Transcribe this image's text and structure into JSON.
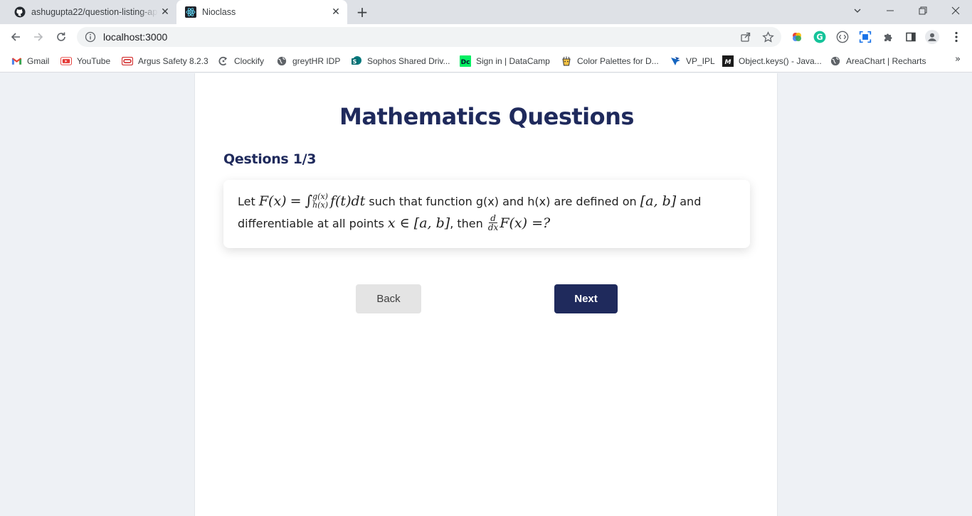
{
  "browser": {
    "tabs": [
      {
        "title": "ashugupta22/question-listing-ap",
        "icon": "github-icon",
        "active": false
      },
      {
        "title": "Nioclass",
        "icon": "react-icon",
        "active": true
      }
    ],
    "address": "localhost:3000",
    "bookmarks": [
      {
        "label": "Gmail",
        "icon": "gmail-icon"
      },
      {
        "label": "YouTube",
        "icon": "youtube-icon"
      },
      {
        "label": "Argus Safety 8.2.3",
        "icon": "oracle-icon"
      },
      {
        "label": "Clockify",
        "icon": "clockify-icon"
      },
      {
        "label": "greytHR IDP",
        "icon": "globe-icon"
      },
      {
        "label": "Sophos Shared Driv...",
        "icon": "sharepoint-icon"
      },
      {
        "label": "Sign in | DataCamp",
        "icon": "datacamp-icon"
      },
      {
        "label": "Color Palettes for D...",
        "icon": "palette-icon"
      },
      {
        "label": "VP_IPL",
        "icon": "vp-icon"
      },
      {
        "label": "Object.keys() - Java...",
        "icon": "mdn-icon"
      },
      {
        "label": "AreaChart | Recharts",
        "icon": "globe-icon"
      }
    ],
    "more_bookmarks": "»"
  },
  "page": {
    "title": "Mathematics Questions",
    "counter": "Qestions 1/3",
    "question": {
      "let": "Let",
      "F_of_x": "F(x)",
      "eq": "=",
      "int_sign": "∫",
      "upper_limit": "g(x)",
      "lower_limit": "h(x)",
      "integrand": "f(t)dt",
      "text_1": "such that function g(x) and h(x) are defined on",
      "interval": "[a, b]",
      "text_2": "and",
      "text_3": "differentiable at all points",
      "membership": "x ∈ [a, b]",
      "text_4": ", then",
      "frac_num": "d",
      "frac_den": "dx",
      "tail": "F(x) =?"
    },
    "back_label": "Back",
    "next_label": "Next"
  },
  "colors": {
    "primary": "#1f2a5c",
    "back_button": "#e4e4e4",
    "page_bg": "#eef1f5"
  }
}
